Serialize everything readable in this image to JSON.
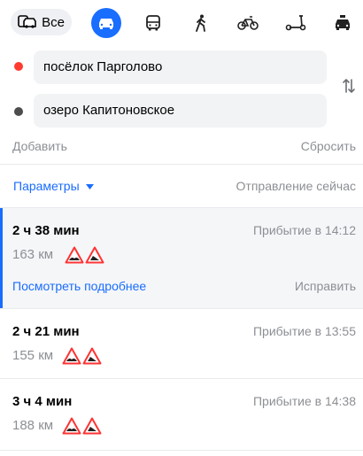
{
  "modes": {
    "all_label": "Все",
    "items": [
      "car-icon",
      "bus-icon",
      "walk-icon",
      "bicycle-icon",
      "scooter-icon",
      "taxi-icon"
    ],
    "active": "car-icon"
  },
  "route": {
    "from": "посёлок Парголово",
    "to": "озеро Капитоновское",
    "add_label": "Добавить",
    "reset_label": "Сбросить"
  },
  "options": {
    "params_label": "Параметры",
    "departure_label": "Отправление сейчас"
  },
  "routes": [
    {
      "duration": "2 ч 38 мин",
      "arrival": "Прибытие в 14:12",
      "distance": "163 км",
      "details_label": "Посмотреть подробнее",
      "fix_label": "Исправить"
    },
    {
      "duration": "2 ч 21 мин",
      "arrival": "Прибытие в 13:55",
      "distance": "155 км"
    },
    {
      "duration": "3 ч 4 мин",
      "arrival": "Прибытие в 14:38",
      "distance": "188 км"
    }
  ],
  "colors": {
    "accent": "#196dff",
    "origin_dot": "#ff3b30",
    "destination_dot": "#4d4d4d",
    "warning": "#ff3333"
  }
}
